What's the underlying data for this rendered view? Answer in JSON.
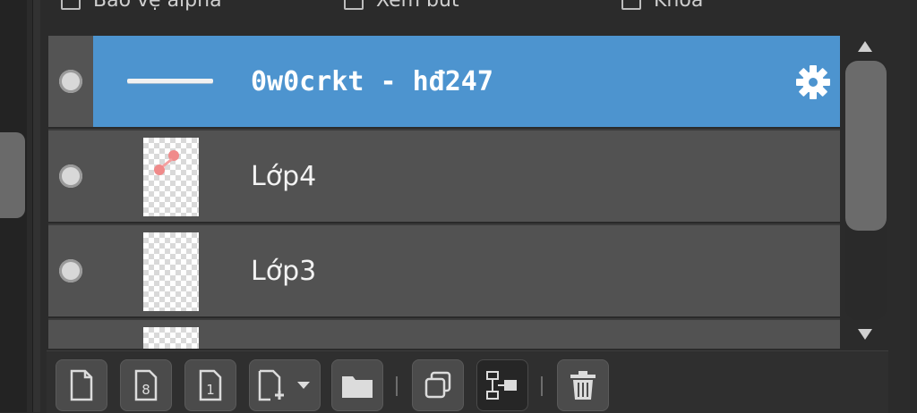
{
  "options": {
    "alpha_label": "Bảo vệ alpha",
    "view_label": "Xem bút",
    "lock_label": "Khóa"
  },
  "layers": [
    {
      "name": "0w0crkt - hđ247",
      "type": "folder",
      "selected": true
    },
    {
      "name": "Lớp4",
      "type": "layer",
      "selected": false
    },
    {
      "name": "Lớp3",
      "type": "layer",
      "selected": false
    },
    {
      "name": "",
      "type": "layer",
      "selected": false
    }
  ],
  "toolbar": {
    "icons": [
      "new-layer-icon",
      "new-8bit-layer-icon",
      "new-1bit-layer-icon",
      "add-layer-dropdown-icon",
      "folder-icon",
      "duplicate-icon",
      "merge-down-icon",
      "trash-icon"
    ]
  },
  "colors": {
    "selected_row": "#4d94cf",
    "row": "#525252",
    "background": "#2b2b2b"
  }
}
